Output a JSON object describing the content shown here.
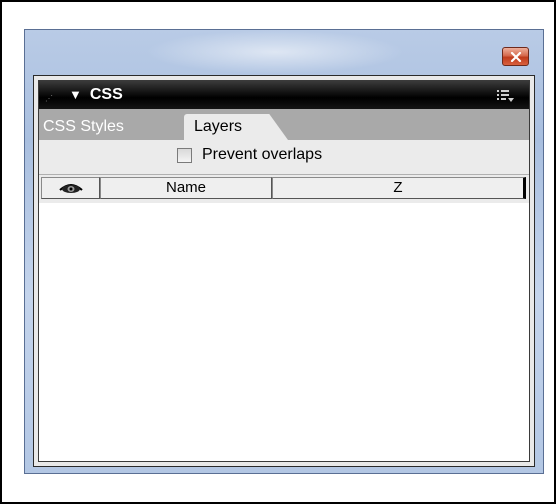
{
  "window": {
    "close_icon": "close-x-icon"
  },
  "panel": {
    "title": "CSS",
    "collapse_icon": "triangle-down-icon",
    "menu_icon": "panel-options-menu-icon"
  },
  "tabs": [
    {
      "label": "CSS Styles",
      "active": false
    },
    {
      "label": "Layers",
      "active": true
    }
  ],
  "options": {
    "prevent_overlaps_label": "Prevent overlaps",
    "prevent_overlaps_checked": false
  },
  "table": {
    "columns": [
      {
        "label": "",
        "icon": "eye-icon"
      },
      {
        "label": "Name"
      },
      {
        "label": "Z"
      }
    ],
    "rows": []
  },
  "colors": {
    "titlebar": "#000000",
    "tabbar": "#a9a9a9",
    "close_button": "#c94a2a"
  }
}
